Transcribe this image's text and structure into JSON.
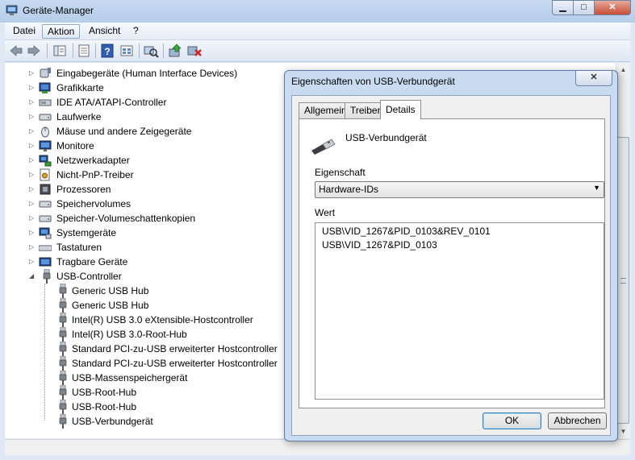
{
  "window": {
    "title": "Geräte-Manager",
    "min_label": "▁",
    "max_label": "□",
    "close_label": "✕"
  },
  "menu": {
    "items": [
      "Datei",
      "Aktion",
      "Ansicht",
      "?"
    ]
  },
  "toolbar": {
    "icons": [
      "back-arrow-icon",
      "forward-arrow-icon",
      "show-hide-tree-icon",
      "properties-icon",
      "help-icon",
      "view-icon",
      "scan-hardware-icon",
      "update-driver-icon",
      "uninstall-icon"
    ]
  },
  "tree": {
    "categories": [
      {
        "label": "Eingabegeräte (Human Interface Devices)",
        "icon": "hid-icon"
      },
      {
        "label": "Grafikkarte",
        "icon": "display-adapter-icon"
      },
      {
        "label": "IDE ATA/ATAPI-Controller",
        "icon": "ide-controller-icon"
      },
      {
        "label": "Laufwerke",
        "icon": "disk-drive-icon"
      },
      {
        "label": "Mäuse und andere Zeigegeräte",
        "icon": "mouse-icon"
      },
      {
        "label": "Monitore",
        "icon": "monitor-icon"
      },
      {
        "label": "Netzwerkadapter",
        "icon": "network-adapter-icon"
      },
      {
        "label": "Nicht-PnP-Treiber",
        "icon": "non-pnp-driver-icon"
      },
      {
        "label": "Prozessoren",
        "icon": "processor-icon"
      },
      {
        "label": "Speichervolumes",
        "icon": "storage-volume-icon"
      },
      {
        "label": "Speicher-Volumeschattenkopien",
        "icon": "shadow-copy-icon"
      },
      {
        "label": "Systemgeräte",
        "icon": "system-device-icon"
      },
      {
        "label": "Tastaturen",
        "icon": "keyboard-icon"
      },
      {
        "label": "Tragbare Geräte",
        "icon": "portable-device-icon"
      },
      {
        "label": "USB-Controller",
        "icon": "usb-icon",
        "expanded": true
      }
    ],
    "usb_children": [
      "Generic USB Hub",
      "Generic USB Hub",
      "Intel(R) USB 3.0 eXtensible-Hostcontroller",
      "Intel(R) USB 3.0-Root-Hub",
      "Standard PCI-zu-USB erweiterter Hostcontroller",
      "Standard PCI-zu-USB erweiterter Hostcontroller",
      "USB-Massenspeichergerät",
      "USB-Root-Hub",
      "USB-Root-Hub",
      "USB-Verbundgerät"
    ]
  },
  "dialog": {
    "title": "Eigenschaften von USB-Verbundgerät",
    "close_label": "✕",
    "tabs": [
      "Allgemein",
      "Treiber",
      "Details"
    ],
    "active_tab": "Details",
    "device_name": "USB-Verbundgerät",
    "property_label": "Eigenschaft",
    "property_value": "Hardware-IDs",
    "value_label": "Wert",
    "values": [
      "USB\\VID_1267&PID_0103&REV_0101",
      "USB\\VID_1267&PID_0103"
    ],
    "ok_label": "OK",
    "cancel_label": "Abbrechen"
  }
}
